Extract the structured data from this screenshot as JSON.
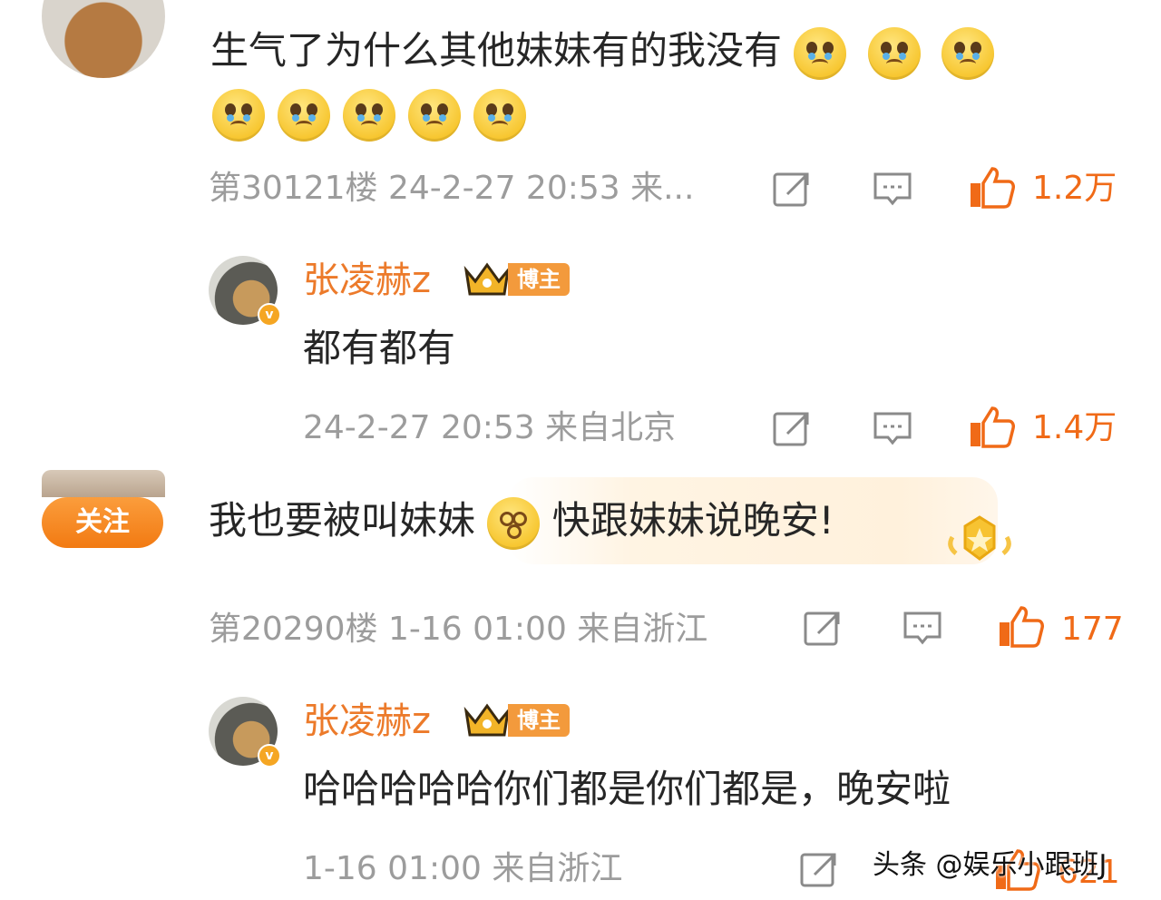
{
  "comments": [
    {
      "text": "生气了为什么其他妹妹有的我没有",
      "meta": "第30121楼 24-2-27 20:53 来...",
      "likes": "1.2万",
      "emojis": [
        "crying-emoji",
        "crying-emoji",
        "crying-emoji",
        "crying-emoji",
        "crying-emoji",
        "crying-emoji",
        "crying-emoji",
        "crying-emoji"
      ],
      "reply": {
        "username": "张凌赫z",
        "badge": "博主",
        "text": "都有都有",
        "meta": "24-2-27 20:53 来自北京",
        "likes": "1.4万"
      }
    },
    {
      "follow_label": "关注",
      "text_before": "我也要被叫妹妹",
      "text_after": "快跟妹妹说晚安!",
      "meta": "第20290楼 1-16 01:00 来自浙江",
      "likes": "177",
      "reply": {
        "username": "张凌赫z",
        "badge": "博主",
        "text": "哈哈哈哈哈你们都是你们都是，晚安啦",
        "meta": "1-16 01:00 来自浙江",
        "likes": "621"
      }
    }
  ],
  "watermark": "头条 @娱乐小跟班J",
  "colors": {
    "accent": "#ec7a2a",
    "like": "#f06a17",
    "meta": "#9c9c9c"
  }
}
